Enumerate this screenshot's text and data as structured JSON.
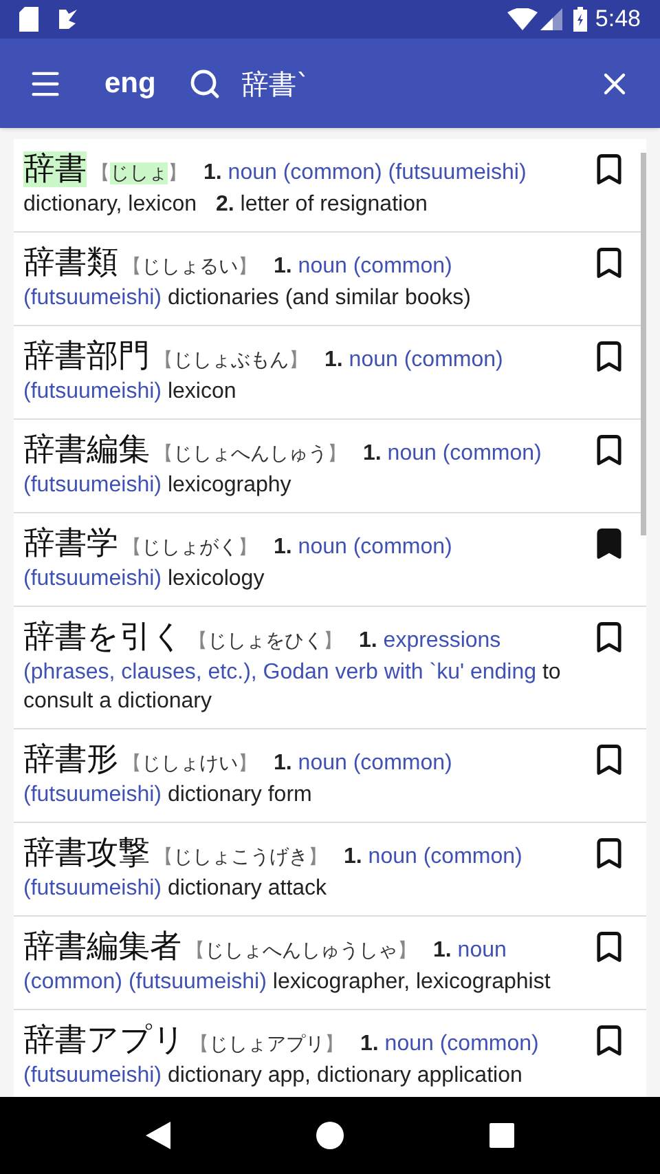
{
  "status_bar": {
    "time": "5:48"
  },
  "toolbar": {
    "language": "eng",
    "query": "辞書`"
  },
  "entries": [
    {
      "word": "辞書",
      "reading": {
        "open": "【",
        "text": "じしょ",
        "close": "】"
      },
      "highlighted": true,
      "bookmarked": false,
      "senses": [
        {
          "num": "1.",
          "pos": "noun (common) (futsuumeishi)",
          "gloss": "dictionary, lexicon"
        },
        {
          "num": "2.",
          "gloss": "letter of resignation"
        }
      ]
    },
    {
      "word": "辞書類",
      "reading": {
        "open": "【",
        "text": "じしょるい",
        "close": "】"
      },
      "highlighted": false,
      "bookmarked": false,
      "senses": [
        {
          "num": "1.",
          "pos": "noun (common) (futsuumeishi)",
          "gloss": "dictionaries (and similar books)"
        }
      ]
    },
    {
      "word": "辞書部門",
      "reading": {
        "open": "【",
        "text": "じしょぶもん",
        "close": "】"
      },
      "highlighted": false,
      "bookmarked": false,
      "senses": [
        {
          "num": "1.",
          "pos": "noun (common) (futsuumeishi)",
          "gloss": "lexicon"
        }
      ]
    },
    {
      "word": "辞書編集",
      "reading": {
        "open": "【",
        "text": "じしょへんしゅう",
        "close": "】"
      },
      "highlighted": false,
      "bookmarked": false,
      "senses": [
        {
          "num": "1.",
          "pos": "noun (common) (futsuumeishi)",
          "gloss": "lexicography"
        }
      ]
    },
    {
      "word": "辞書学",
      "reading": {
        "open": "【",
        "text": "じしょがく",
        "close": "】"
      },
      "highlighted": false,
      "bookmarked": true,
      "senses": [
        {
          "num": "1.",
          "pos": "noun (common) (futsuumeishi)",
          "gloss": "lexicology"
        }
      ]
    },
    {
      "word": "辞書を引く",
      "reading": {
        "open": "【",
        "text": "じしょをひく",
        "close": "】"
      },
      "highlighted": false,
      "bookmarked": false,
      "senses": [
        {
          "num": "1.",
          "pos": "expressions (phrases, clauses, etc.), Godan verb with `ku' ending",
          "gloss": "to consult a dictionary"
        }
      ]
    },
    {
      "word": "辞書形",
      "reading": {
        "open": "【",
        "text": "じしょけい",
        "close": "】"
      },
      "highlighted": false,
      "bookmarked": false,
      "senses": [
        {
          "num": "1.",
          "pos": "noun (common) (futsuumeishi)",
          "gloss": "dictionary form"
        }
      ]
    },
    {
      "word": "辞書攻撃",
      "reading": {
        "open": "【",
        "text": "じしょこうげき",
        "close": "】"
      },
      "highlighted": false,
      "bookmarked": false,
      "senses": [
        {
          "num": "1.",
          "pos": "noun (common) (futsuumeishi)",
          "gloss": "dictionary attack"
        }
      ]
    },
    {
      "word": "辞書編集者",
      "reading": {
        "open": "【",
        "text": "じしょへんしゅうしゃ",
        "close": "】"
      },
      "highlighted": false,
      "bookmarked": false,
      "senses": [
        {
          "num": "1.",
          "pos": "noun (common) (futsuumeishi)",
          "gloss": "lexicographer, lexicographist"
        }
      ]
    },
    {
      "word": "辞書アプリ",
      "reading": {
        "open": "【",
        "text": "じしょアプリ",
        "close": "】"
      },
      "highlighted": false,
      "bookmarked": false,
      "senses": [
        {
          "num": "1.",
          "pos": "noun (common) (futsuumeishi)",
          "gloss": "dictionary app, dictionary application"
        }
      ]
    }
  ]
}
